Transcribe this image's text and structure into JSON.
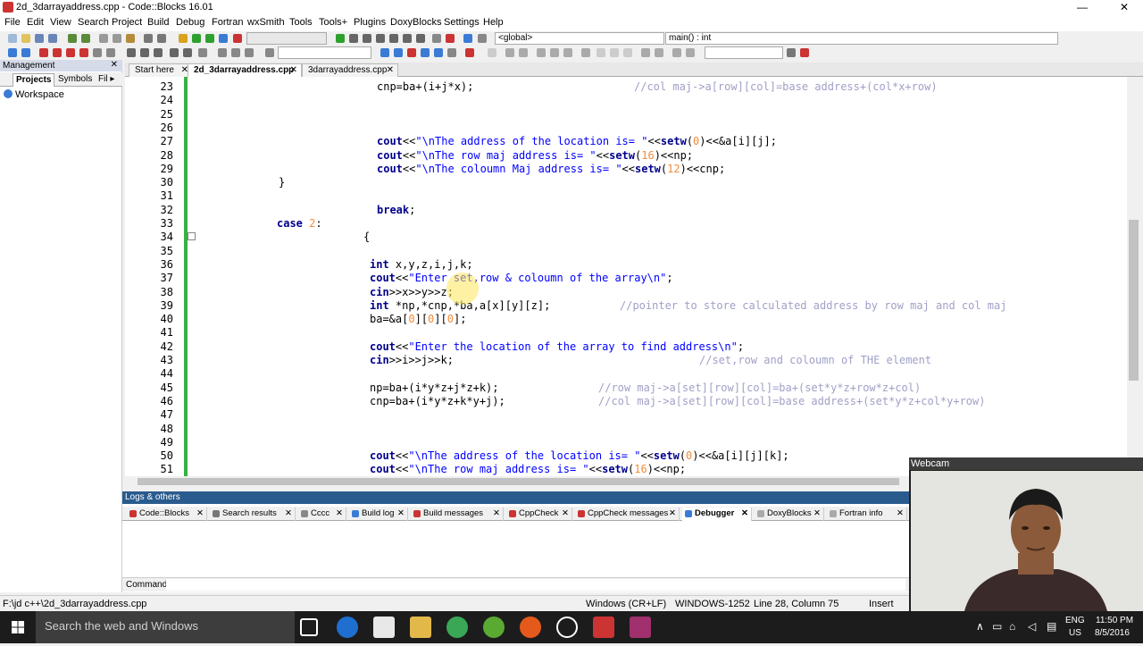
{
  "window": {
    "title": "2d_3darrayaddress.cpp - Code::Blocks 16.01",
    "controls": [
      "—",
      "❐",
      "✕"
    ]
  },
  "menu": [
    "File",
    "Edit",
    "View",
    "Search",
    "Project",
    "Build",
    "Debug",
    "Fortran",
    "wxSmith",
    "Tools",
    "Tools+",
    "Plugins",
    "DoxyBlocks",
    "Settings",
    "Help"
  ],
  "toolbar": {
    "scope_combo": "<global>",
    "function_combo": "main() : int"
  },
  "management": {
    "title": "Management",
    "close": "✕",
    "tabs": [
      "Projects",
      "Symbols",
      "Fil ▸"
    ],
    "workspace": "Workspace"
  },
  "editor_tabs": [
    {
      "label": "Start here",
      "close": "✕"
    },
    {
      "label": "2d_3darrayaddress.cpp",
      "close": "✕"
    },
    {
      "label": "3darrayaddress.cpp",
      "close": "✕"
    }
  ],
  "code_lines": [
    {
      "n": "23",
      "text": "cnp=ba+(i+j*x);",
      "comment": "//col maj->a[row][col]=base address+(col*x+row)"
    },
    {
      "n": "24",
      "text": ""
    },
    {
      "n": "25",
      "text": ""
    },
    {
      "n": "26",
      "text": ""
    },
    {
      "n": "27",
      "text": "cout<<\"\\nThe address of the location is= \"<<setw(0)<<&a[i][j];"
    },
    {
      "n": "28",
      "text": "cout<<\"\\nThe row maj address is= \"<<setw(16)<<np;"
    },
    {
      "n": "29",
      "text": "cout<<\"\\nThe coloumn Maj address is= \"<<setw(12)<<cnp;"
    },
    {
      "n": "30",
      "text": "}"
    },
    {
      "n": "31",
      "text": ""
    },
    {
      "n": "32",
      "text": "break;"
    },
    {
      "n": "33",
      "text": "case 2:"
    },
    {
      "n": "34",
      "text": "{"
    },
    {
      "n": "35",
      "text": ""
    },
    {
      "n": "36",
      "text": "int x,y,z,i,j,k;"
    },
    {
      "n": "37",
      "text": "cout<<\"Enter set,row & coloumn of the array\\n\";"
    },
    {
      "n": "38",
      "text": "cin>>x>>y>>z;"
    },
    {
      "n": "39",
      "text": "int *np,*cnp,*ba,a[x][y][z];",
      "comment": "//pointer to store calculated address by row maj and col maj"
    },
    {
      "n": "40",
      "text": "ba=&a[0][0][0];"
    },
    {
      "n": "41",
      "text": ""
    },
    {
      "n": "42",
      "text": "cout<<\"Enter the location of the array to find address\\n\";"
    },
    {
      "n": "43",
      "text": "cin>>i>>j>>k;",
      "comment": "//set,row and coloumn of THE element"
    },
    {
      "n": "44",
      "text": ""
    },
    {
      "n": "45",
      "text": "np=ba+(i*y*z+j*z+k);",
      "comment": "//row maj->a[set][row][col]=ba+(set*y*z+row*z+col)"
    },
    {
      "n": "46",
      "text": "cnp=ba+(i*y*z+k*y+j);",
      "comment": "//col maj->a[set][row][col]=base address+(set*y*z+col*y+row)"
    },
    {
      "n": "47",
      "text": ""
    },
    {
      "n": "48",
      "text": ""
    },
    {
      "n": "49",
      "text": ""
    },
    {
      "n": "50",
      "text": "cout<<\"\\nThe address of the location is= \"<<setw(0)<<&a[i][j][k];"
    },
    {
      "n": "51",
      "text": "cout<<\"\\nThe row maj address is= \"<<setw(16)<<np;"
    }
  ],
  "logs": {
    "title": "Logs & others",
    "tabs": [
      "Code::Blocks",
      "Search results",
      "Cccc",
      "Build log",
      "Build messages",
      "CppCheck",
      "CppCheck messages",
      "Debugger",
      "DoxyBlocks",
      "Fortran info"
    ],
    "active_tab": "Debugger",
    "command_label": "Command:"
  },
  "status": {
    "path": "F:\\jd c++\\2d_3darrayaddress.cpp",
    "eol": "Windows (CR+LF)",
    "encoding": "WINDOWS-1252",
    "position": "Line 28, Column 75",
    "mode": "Insert"
  },
  "webcam": {
    "title": "Webcam"
  },
  "taskbar": {
    "search_placeholder": "Search the web and Windows",
    "lang": "ENG",
    "region": "US",
    "time": "11:50 PM",
    "date": "8/5/2016"
  },
  "colors": {
    "keyword": "#00008b",
    "string": "#0000ff",
    "number": "#f08c3c",
    "comment": "#a0a0c8",
    "fold_bar": "#3cb043",
    "logs_header": "#2a5b8e"
  }
}
